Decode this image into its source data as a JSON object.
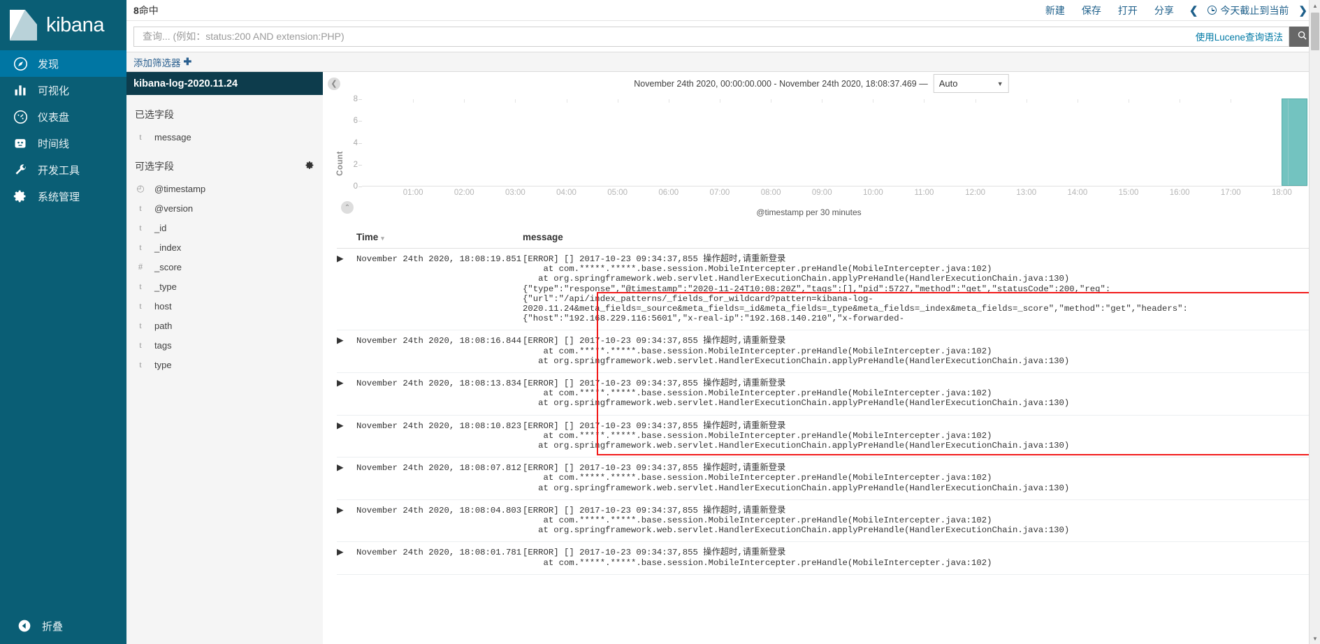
{
  "app": {
    "logo_text": "kibana"
  },
  "nav": {
    "items": [
      {
        "label": "发现",
        "icon": "compass-icon",
        "active": true
      },
      {
        "label": "可视化",
        "icon": "bar-chart-icon",
        "active": false
      },
      {
        "label": "仪表盘",
        "icon": "dashboard-icon",
        "active": false
      },
      {
        "label": "时间线",
        "icon": "timeline-icon",
        "active": false
      },
      {
        "label": "开发工具",
        "icon": "wrench-icon",
        "active": false
      },
      {
        "label": "系统管理",
        "icon": "gear-icon",
        "active": false
      }
    ],
    "collapse_label": "折叠"
  },
  "topbar": {
    "hits_count": "8",
    "hits_suffix": "命中",
    "actions": [
      "新建",
      "保存",
      "打开",
      "分享"
    ],
    "prev_arrow": "❮",
    "next_arrow": "❯",
    "time_range_label": "今天截止到当前"
  },
  "query": {
    "placeholder": "查询... (例如：status:200 AND extension:PHP)",
    "value": "",
    "lucene_link": "使用Lucene查询语法",
    "search_icon": "search-icon"
  },
  "filterbar": {
    "add_filter": "添加筛选器",
    "plus": "✚"
  },
  "fields_panel": {
    "index_pattern": "kibana-log-2020.11.24",
    "selected_title": "已选字段",
    "available_title": "可选字段",
    "selected": [
      {
        "type": "t",
        "name": "message"
      }
    ],
    "available": [
      {
        "type": "◴",
        "name": "@timestamp"
      },
      {
        "type": "t",
        "name": "@version"
      },
      {
        "type": "t",
        "name": "_id"
      },
      {
        "type": "t",
        "name": "_index"
      },
      {
        "type": "#",
        "name": "_score"
      },
      {
        "type": "t",
        "name": "_type"
      },
      {
        "type": "t",
        "name": "host"
      },
      {
        "type": "t",
        "name": "path"
      },
      {
        "type": "t",
        "name": "tags"
      },
      {
        "type": "t",
        "name": "type"
      }
    ]
  },
  "chart_panel": {
    "time_range": "November 24th 2020, 00:00:00.000 - November 24th 2020, 18:08:37.469 —",
    "interval": "Auto",
    "collapse_left_icon": "chevron-left-icon",
    "collapse_up_icon": "chevron-up-icon"
  },
  "chart_data": {
    "type": "bar",
    "title": "",
    "xlabel": "@timestamp per 30 minutes",
    "ylabel": "Count",
    "ylim": [
      0,
      8
    ],
    "yticks": [
      0,
      2,
      4,
      6,
      8
    ],
    "xticks": [
      "01:00",
      "02:00",
      "03:00",
      "04:00",
      "05:00",
      "06:00",
      "07:00",
      "08:00",
      "09:00",
      "10:00",
      "11:00",
      "12:00",
      "13:00",
      "14:00",
      "15:00",
      "16:00",
      "17:00",
      "18:00"
    ],
    "x_domain_start": "00:00",
    "x_domain_end": "18:30",
    "categories": [
      "18:00"
    ],
    "values": [
      8
    ],
    "bar_color": "#6cc0bd",
    "grid": false,
    "legend": "none"
  },
  "table": {
    "columns": [
      "Time",
      "message"
    ],
    "sort_caret": "▾",
    "expand_caret": "▶",
    "rows": [
      {
        "time": "November 24th 2020, 18:08:19.851",
        "lines": [
          "[ERROR] [] 2017-10-23 09:34:37,855 操作超时,请重新登录",
          "    at com.*****.*****.base.session.MobileIntercepter.preHandle(MobileIntercepter.java:102)",
          "   at org.springframework.web.servlet.HandlerExecutionChain.applyPreHandle(HandlerExecutionChain.java:130)",
          "{\"type\":\"response\",\"@timestamp\":\"2020-11-24T10:08:20Z\",\"tags\":[],\"pid\":5727,\"method\":\"get\",\"statusCode\":200,\"req\":",
          "{\"url\":\"/api/index_patterns/_fields_for_wildcard?pattern=kibana-log-",
          "2020.11.24&meta_fields=_source&meta_fields=_id&meta_fields=_type&meta_fields=_index&meta_fields=_score\",\"method\":\"get\",\"headers\":",
          "{\"host\":\"192.168.229.116:5601\",\"x-real-ip\":\"192.168.140.210\",\"x-forwarded-"
        ],
        "highlighted": true
      },
      {
        "time": "November 24th 2020, 18:08:16.844",
        "lines": [
          "[ERROR] [] 2017-10-23 09:34:37,855 操作超时,请重新登录",
          "    at com.*****.*****.base.session.MobileIntercepter.preHandle(MobileIntercepter.java:102)",
          "   at org.springframework.web.servlet.HandlerExecutionChain.applyPreHandle(HandlerExecutionChain.java:130)"
        ],
        "highlighted": true
      },
      {
        "time": "November 24th 2020, 18:08:13.834",
        "lines": [
          "[ERROR] [] 2017-10-23 09:34:37,855 操作超时,请重新登录",
          "    at com.*****.*****.base.session.MobileIntercepter.preHandle(MobileIntercepter.java:102)",
          "   at org.springframework.web.servlet.HandlerExecutionChain.applyPreHandle(HandlerExecutionChain.java:130)"
        ],
        "highlighted": true
      },
      {
        "time": "November 24th 2020, 18:08:10.823",
        "lines": [
          "[ERROR] [] 2017-10-23 09:34:37,855 操作超时,请重新登录",
          "    at com.*****.*****.base.session.MobileIntercepter.preHandle(MobileIntercepter.java:102)",
          "   at org.springframework.web.servlet.HandlerExecutionChain.applyPreHandle(HandlerExecutionChain.java:130)"
        ],
        "highlighted": false
      },
      {
        "time": "November 24th 2020, 18:08:07.812",
        "lines": [
          "[ERROR] [] 2017-10-23 09:34:37,855 操作超时,请重新登录",
          "    at com.*****.*****.base.session.MobileIntercepter.preHandle(MobileIntercepter.java:102)",
          "   at org.springframework.web.servlet.HandlerExecutionChain.applyPreHandle(HandlerExecutionChain.java:130)"
        ],
        "highlighted": false
      },
      {
        "time": "November 24th 2020, 18:08:04.803",
        "lines": [
          "[ERROR] [] 2017-10-23 09:34:37,855 操作超时,请重新登录",
          "    at com.*****.*****.base.session.MobileIntercepter.preHandle(MobileIntercepter.java:102)",
          "   at org.springframework.web.servlet.HandlerExecutionChain.applyPreHandle(HandlerExecutionChain.java:130)"
        ],
        "highlighted": false
      },
      {
        "time": "November 24th 2020, 18:08:01.781",
        "lines": [
          "[ERROR] [] 2017-10-23 09:34:37,855 操作超时,请重新登录",
          "    at com.*****.*****.base.session.MobileIntercepter.preHandle(MobileIntercepter.java:102)"
        ],
        "highlighted": false
      }
    ]
  },
  "colors": {
    "nav_bg": "#0a5e75",
    "nav_active": "#0076a3",
    "index_pattern_bg": "#0d3c4c",
    "accent_link": "#1d5f8a",
    "bar": "#6cc0bd",
    "highlight_border": "#f21a1a"
  },
  "scrollbar": {
    "up": "▲",
    "down": "▼"
  }
}
